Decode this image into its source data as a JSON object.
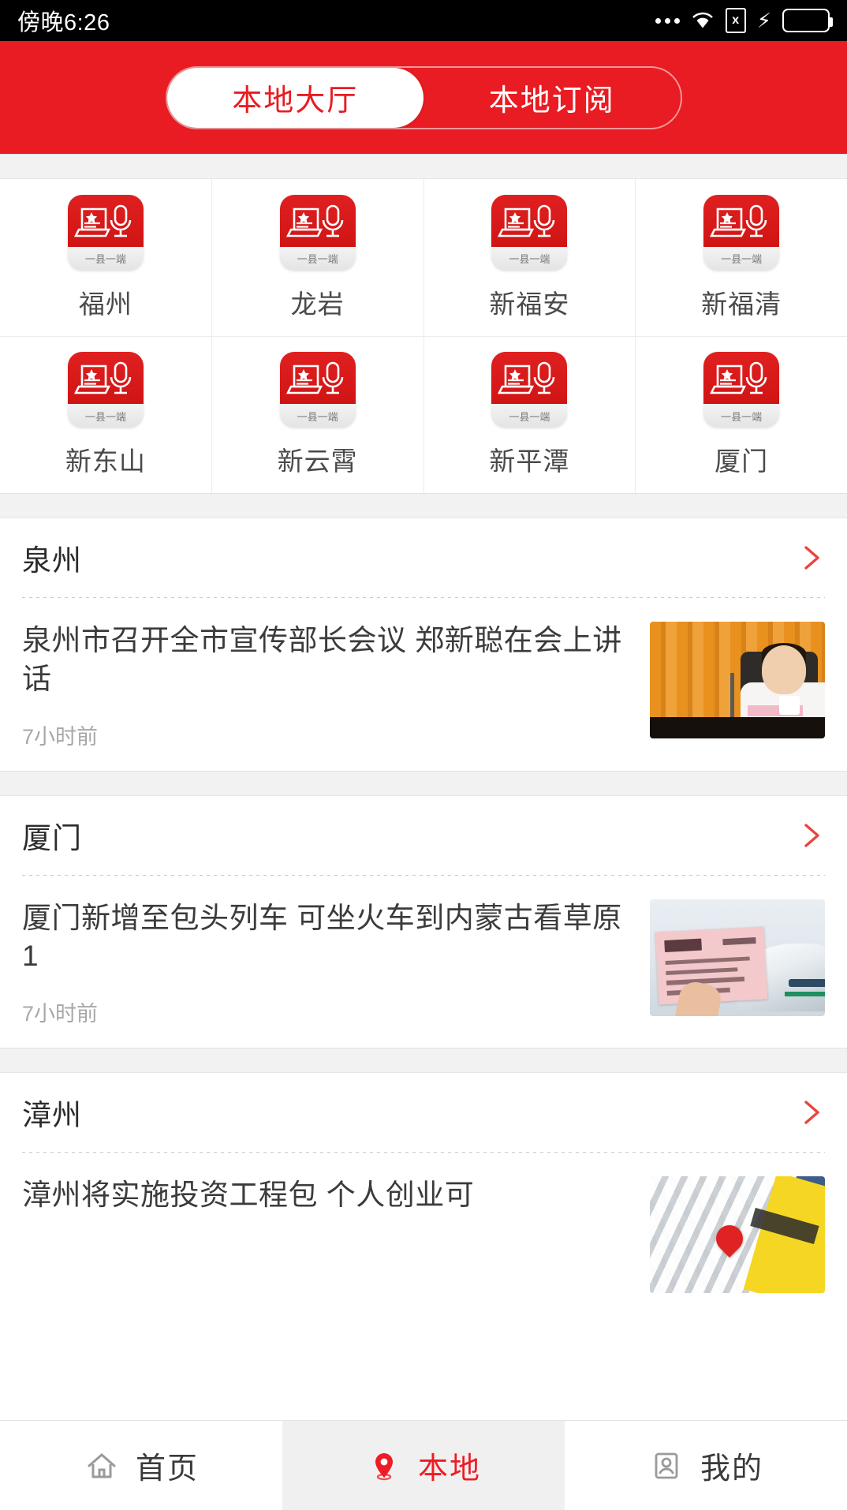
{
  "statusbar": {
    "time": "傍晚6:26",
    "icons": [
      "more-dots-icon",
      "wifi-icon",
      "sim-x-icon",
      "charging-bolt-icon",
      "battery-icon"
    ],
    "sim_label": "x"
  },
  "header": {
    "tabs": [
      {
        "label": "本地大厅",
        "active": true
      },
      {
        "label": "本地订阅",
        "active": false
      }
    ],
    "background_color": "#e81c22",
    "active_tab_text_color": "#e81c22"
  },
  "city_grid": {
    "icon_caption": "一县一端",
    "rows": [
      [
        {
          "label": "福州"
        },
        {
          "label": "龙岩"
        },
        {
          "label": "新福安"
        },
        {
          "label": "新福清"
        }
      ],
      [
        {
          "label": "新东山"
        },
        {
          "label": "新云霄"
        },
        {
          "label": "新平潭"
        },
        {
          "label": "厦门"
        }
      ]
    ]
  },
  "sections": [
    {
      "title": "泉州",
      "arrow": "chevron-right-icon",
      "news": [
        {
          "title": "泉州市召开全市宣传部长会议 郑新聪在会上讲话",
          "time": "7小时前",
          "thumb": "photo-man-at-desk-orange-curtain"
        }
      ]
    },
    {
      "title": "厦门",
      "arrow": "chevron-right-icon",
      "news": [
        {
          "title": "厦门新增至包头列车 可坐火车到内蒙古看草原1",
          "time": "7小时前",
          "thumb": "photo-pink-train-ticket"
        }
      ]
    },
    {
      "title": "漳州",
      "arrow": "chevron-right-icon",
      "news": [
        {
          "title": "漳州将实施投资工程包 个人创业可",
          "time": "",
          "thumb": "photo-white-paper-arrows-red-one"
        }
      ]
    }
  ],
  "bottom_nav": {
    "items": [
      {
        "label": "首页",
        "icon": "home-icon",
        "active": false
      },
      {
        "label": "本地",
        "icon": "location-pin-icon",
        "active": true
      },
      {
        "label": "我的",
        "icon": "person-card-icon",
        "active": false
      }
    ],
    "active_color": "#ee1c25"
  }
}
